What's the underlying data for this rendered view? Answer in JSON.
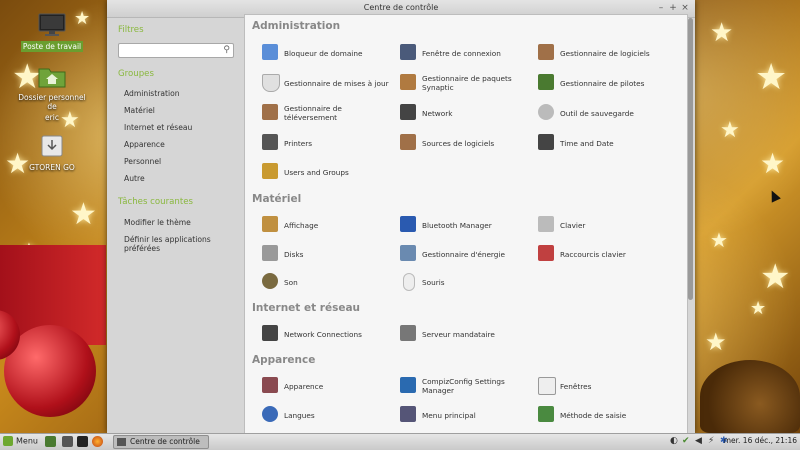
{
  "desktop": {
    "icons": [
      {
        "label": "Poste de travail",
        "icon": "computer-icon"
      },
      {
        "label": "Dossier personnel de",
        "label2": "eric",
        "icon": "home-folder-icon"
      },
      {
        "label": "GTOREN GO",
        "icon": "drive-icon"
      }
    ]
  },
  "window": {
    "title": "Centre de contrôle",
    "buttons": {
      "minimize": "–",
      "maximize": "+",
      "close": "×"
    }
  },
  "sidebar": {
    "filter_heading": "Filtres",
    "search_placeholder": "",
    "groups_heading": "Groupes",
    "groups": [
      "Administration",
      "Matériel",
      "Internet et réseau",
      "Apparence",
      "Personnel",
      "Autre"
    ],
    "tasks_heading": "Tâches courantes",
    "tasks": [
      "Modifier le thème",
      "Définir les applications préférées"
    ]
  },
  "main": {
    "categories": [
      {
        "title": "Administration",
        "items": [
          {
            "label": "Bloqueur de domaine",
            "icon": "domain-blocker-icon",
            "color": "#5a8ed8"
          },
          {
            "label": "Fenêtre de connexion",
            "icon": "login-window-icon",
            "color": "#4a5a7a"
          },
          {
            "label": "Gestionnaire de logiciels",
            "icon": "software-manager-icon",
            "color": "#a07048"
          },
          {
            "label": "Gestionnaire de mises à jour",
            "icon": "shield-icon",
            "color": "#e0e0e0"
          },
          {
            "label": "Gestionnaire de paquets Synaptic",
            "icon": "synaptic-icon",
            "color": "#b07a40"
          },
          {
            "label": "Gestionnaire de pilotes",
            "icon": "chip-icon",
            "color": "#4a7a30"
          },
          {
            "label": "Gestionnaire de téléversement",
            "icon": "upload-icon",
            "color": "#a07048"
          },
          {
            "label": "Network",
            "icon": "network-icon",
            "color": "#444444"
          },
          {
            "label": "Outil de sauvegarde",
            "icon": "backup-icon",
            "color": "#bbbbbb"
          },
          {
            "label": "Printers",
            "icon": "printer-icon",
            "color": "#555555"
          },
          {
            "label": "Sources de logiciels",
            "icon": "software-sources-icon",
            "color": "#a07048"
          },
          {
            "label": "Time and Date",
            "icon": "clock-icon",
            "color": "#444444"
          },
          {
            "label": "Users and Groups",
            "icon": "users-icon",
            "color": "#c99a30"
          }
        ]
      },
      {
        "title": "Matériel",
        "items": [
          {
            "label": "Affichage",
            "icon": "display-icon",
            "color": "#c09040"
          },
          {
            "label": "Bluetooth Manager",
            "icon": "bluetooth-icon",
            "color": "#2a5ab0"
          },
          {
            "label": "Clavier",
            "icon": "keyboard-icon",
            "color": "#bbbbbb"
          },
          {
            "label": "Disks",
            "icon": "disks-icon",
            "color": "#999999"
          },
          {
            "label": "Gestionnaire d'énergie",
            "icon": "power-icon",
            "color": "#6a8ab0"
          },
          {
            "label": "Raccourcis clavier",
            "icon": "shortcuts-icon",
            "color": "#c04040"
          },
          {
            "label": "Son",
            "icon": "speaker-icon",
            "color": "#7a6a40"
          },
          {
            "label": "Souris",
            "icon": "mouse-icon",
            "color": "#eeeeee"
          }
        ]
      },
      {
        "title": "Internet et réseau",
        "items": [
          {
            "label": "Network Connections",
            "icon": "network-connections-icon",
            "color": "#444444"
          },
          {
            "label": "Serveur mandataire",
            "icon": "proxy-icon",
            "color": "#777777"
          }
        ]
      },
      {
        "title": "Apparence",
        "items": [
          {
            "label": "Apparence",
            "icon": "appearance-icon",
            "color": "#8a4a50"
          },
          {
            "label": "CompizConfig Settings Manager",
            "icon": "compiz-icon",
            "color": "#2a6ab0"
          },
          {
            "label": "Fenêtres",
            "icon": "windows-icon",
            "color": "#eeeeee"
          },
          {
            "label": "Langues",
            "icon": "languages-icon",
            "color": "#3a6ab8"
          },
          {
            "label": "Menu principal",
            "icon": "main-menu-icon",
            "color": "#555577"
          },
          {
            "label": "Méthode de saisie",
            "icon": "input-method-icon",
            "color": "#4a8a40"
          }
        ]
      }
    ]
  },
  "taskbar": {
    "menu_label": "Menu",
    "task_label": "Centre de contrôle",
    "clock": "mer. 16 déc., 21:16"
  }
}
